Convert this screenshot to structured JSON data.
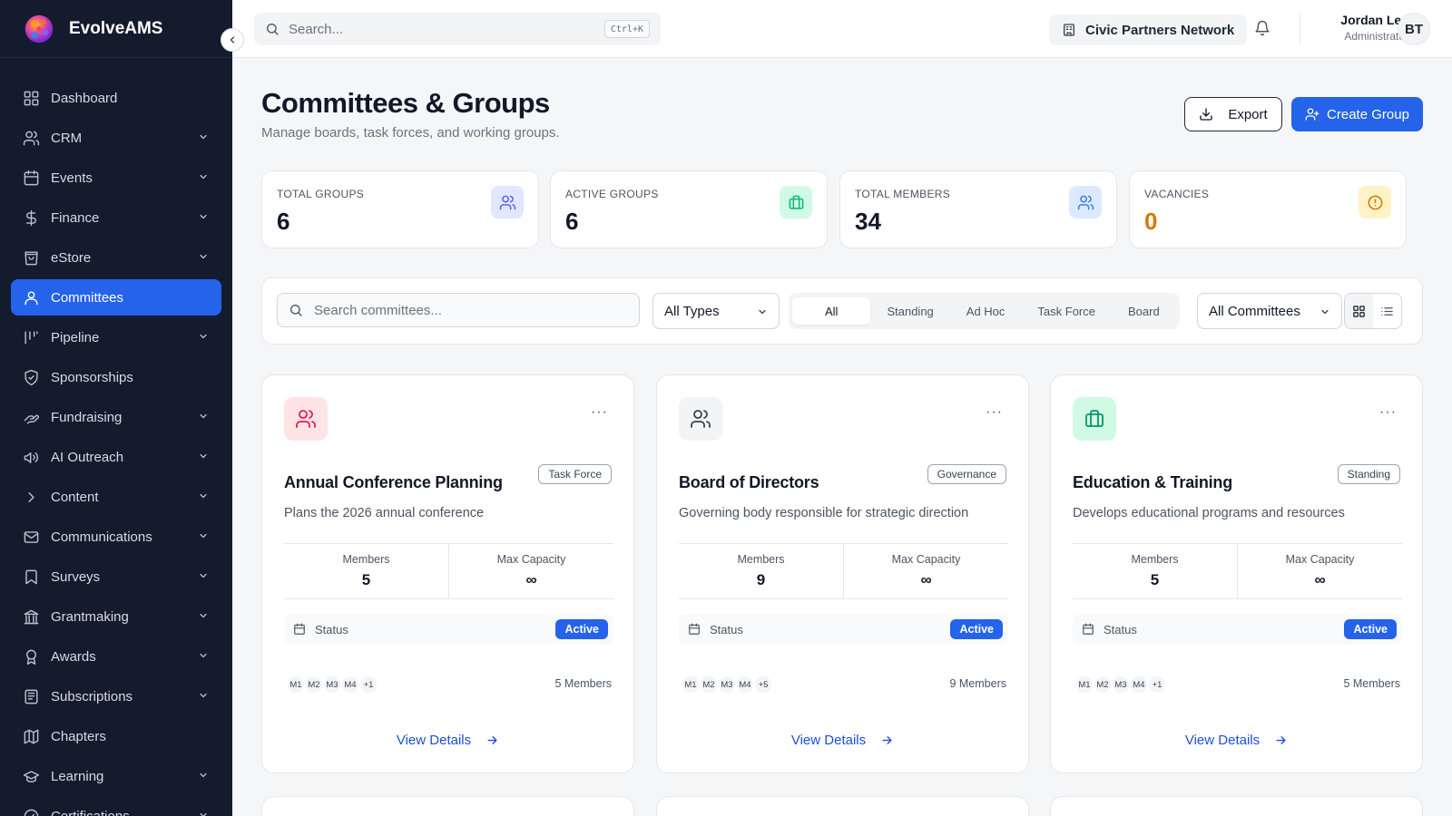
{
  "app": {
    "name": "EvolveAMS"
  },
  "sidebar": {
    "items": [
      {
        "label": "Dashboard",
        "icon": "grid-icon",
        "expandable": false
      },
      {
        "label": "CRM",
        "icon": "users-icon",
        "expandable": true
      },
      {
        "label": "Events",
        "icon": "calendar-icon",
        "expandable": true
      },
      {
        "label": "Finance",
        "icon": "dollar-icon",
        "expandable": true
      },
      {
        "label": "eStore",
        "icon": "store-icon",
        "expandable": true
      },
      {
        "label": "Committees",
        "icon": "user-icon",
        "expandable": false,
        "active": true
      },
      {
        "label": "Pipeline",
        "icon": "pipeline-icon",
        "expandable": true
      },
      {
        "label": "Sponsorships",
        "icon": "shield-icon",
        "expandable": false
      },
      {
        "label": "Fundraising",
        "icon": "hand-heart-icon",
        "expandable": true
      },
      {
        "label": "AI Outreach",
        "icon": "megaphone-icon",
        "expandable": true
      },
      {
        "label": "Content",
        "icon": "chevron-right-icon",
        "expandable": true
      },
      {
        "label": "Communications",
        "icon": "mail-icon",
        "expandable": true
      },
      {
        "label": "Surveys",
        "icon": "bookmark-icon",
        "expandable": true
      },
      {
        "label": "Grantmaking",
        "icon": "bank-icon",
        "expandable": true
      },
      {
        "label": "Awards",
        "icon": "award-icon",
        "expandable": true
      },
      {
        "label": "Subscriptions",
        "icon": "newspaper-icon",
        "expandable": true
      },
      {
        "label": "Chapters",
        "icon": "map-icon",
        "expandable": false
      },
      {
        "label": "Learning",
        "icon": "graduation-cap-icon",
        "expandable": true
      },
      {
        "label": "Certifications",
        "icon": "check-circle-icon",
        "expandable": true
      }
    ]
  },
  "topbar": {
    "search_placeholder": "Search...",
    "shortcut": "Ctrl+K",
    "org_name": "Civic Partners Network",
    "user_name": "Jordan Lee",
    "user_role": "Administrator",
    "avatar_initials": "BT"
  },
  "page": {
    "title": "Committees & Groups",
    "subtitle": "Manage boards, task forces, and working groups.",
    "export_label": "Export",
    "create_label": "Create Group"
  },
  "stats": [
    {
      "label": "TOTAL GROUPS",
      "value": "6",
      "icon": "users-icon",
      "color": "#6366f1",
      "bg": "#e0e7ff"
    },
    {
      "label": "ACTIVE GROUPS",
      "value": "6",
      "icon": "briefcase-icon",
      "color": "#10b981",
      "bg": "#d1fae5"
    },
    {
      "label": "TOTAL MEMBERS",
      "value": "34",
      "icon": "users-icon",
      "color": "#3b82f6",
      "bg": "#dbeafe"
    },
    {
      "label": "VACANCIES",
      "value": "0",
      "icon": "alert-circle-icon",
      "color": "#d97706",
      "bg": "#fef3c7"
    }
  ],
  "filters": {
    "search_placeholder": "Search committees...",
    "type_select": "All Types",
    "segments": [
      "All",
      "Standing",
      "Ad Hoc",
      "Task Force",
      "Board"
    ],
    "scope_select": "All Committees"
  },
  "cards": [
    {
      "title": "Annual Conference Planning",
      "badge": "Task Force",
      "description": "Plans the 2026 annual conference",
      "members_label": "Members",
      "members": "5",
      "capacity_label": "Max Capacity",
      "capacity": "∞",
      "status_label": "Status",
      "status": "Active",
      "avatars": [
        "M1",
        "M2",
        "M3",
        "M4",
        "+1"
      ],
      "members_count": "5 Members",
      "link": "View Details",
      "icon": "users-icon",
      "icon_color": "#e11d48",
      "icon_bg": "#ffe4e6"
    },
    {
      "title": "Board of Directors",
      "badge": "Governance",
      "description": "Governing body responsible for strategic direction",
      "members_label": "Members",
      "members": "9",
      "capacity_label": "Max Capacity",
      "capacity": "∞",
      "status_label": "Status",
      "status": "Active",
      "avatars": [
        "M1",
        "M2",
        "M3",
        "M4",
        "+5"
      ],
      "members_count": "9 Members",
      "link": "View Details",
      "icon": "users-icon",
      "icon_color": "#374151",
      "icon_bg": "#f3f4f6"
    },
    {
      "title": "Education & Training",
      "badge": "Standing",
      "description": "Develops educational programs and resources",
      "members_label": "Members",
      "members": "5",
      "capacity_label": "Max Capacity",
      "capacity": "∞",
      "status_label": "Status",
      "status": "Active",
      "avatars": [
        "M1",
        "M2",
        "M3",
        "M4",
        "+1"
      ],
      "members_count": "5 Members",
      "link": "View Details",
      "icon": "briefcase-icon",
      "icon_color": "#059669",
      "icon_bg": "#d1fae5"
    }
  ],
  "colors": {
    "sidebar_bg": "#141b2d",
    "accent": "#2563eb",
    "page_bg": "#f5f6f8"
  }
}
